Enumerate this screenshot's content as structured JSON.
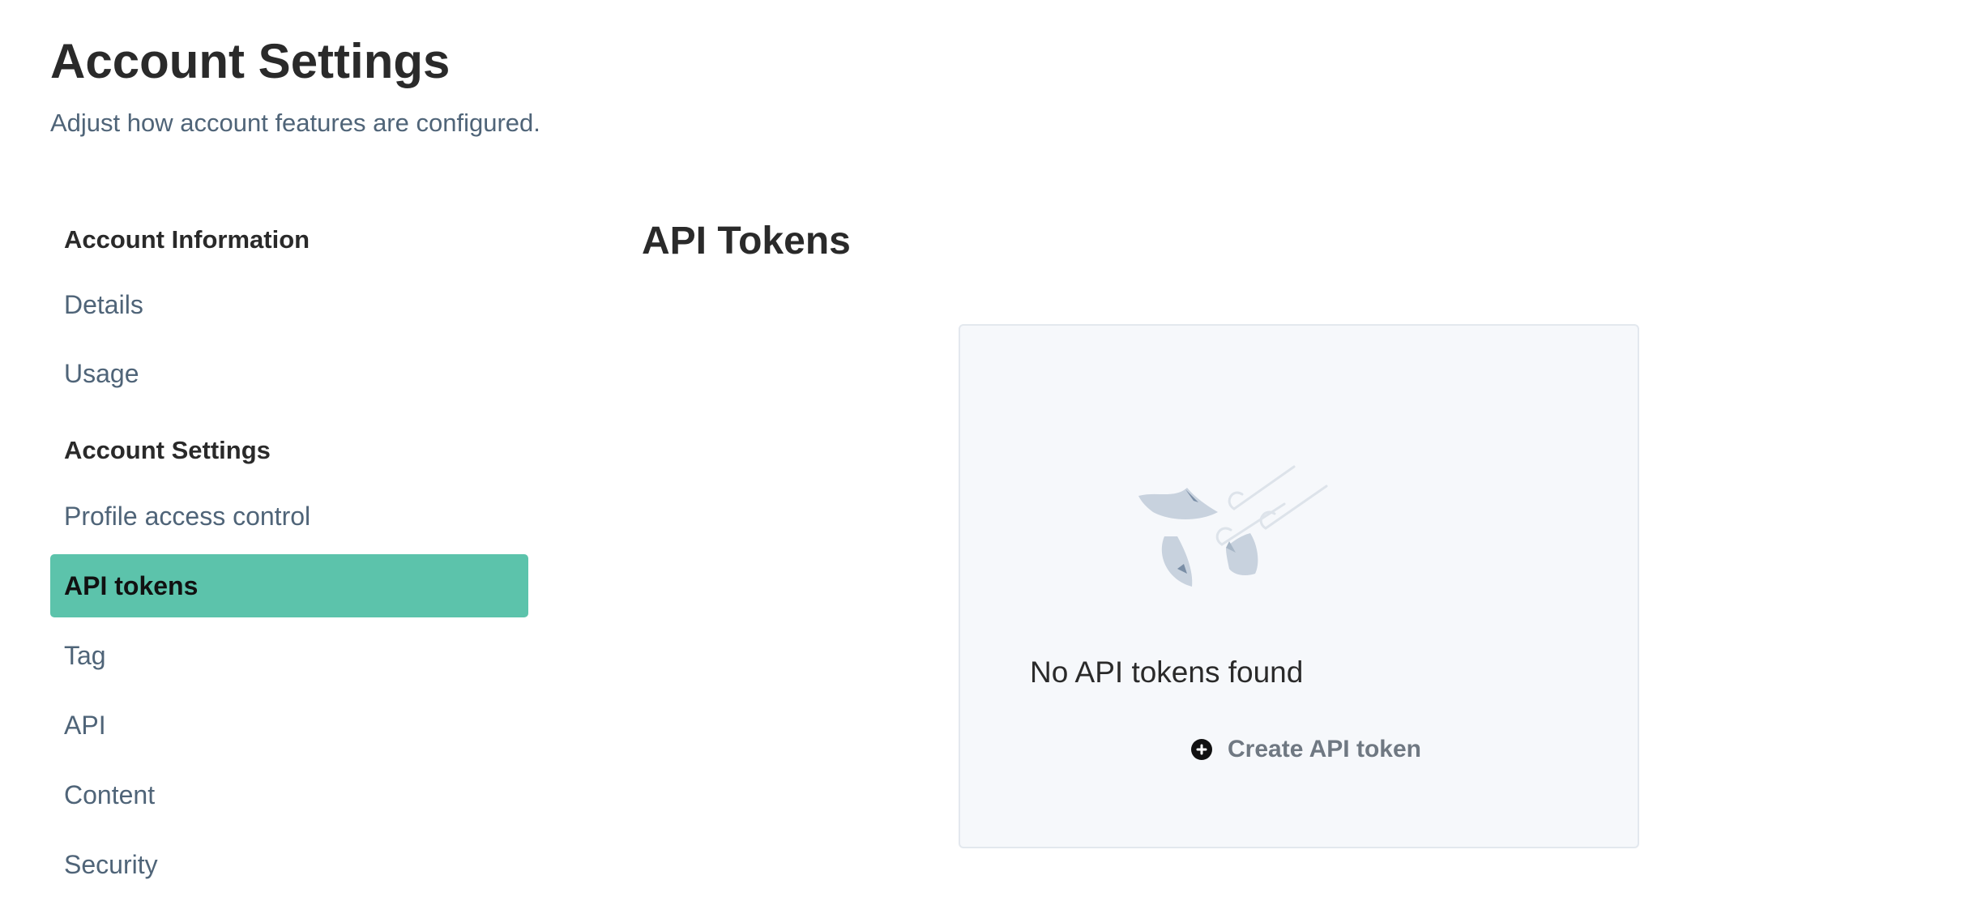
{
  "header": {
    "title": "Account Settings",
    "subtitle": "Adjust how account features are configured."
  },
  "sidebar": {
    "groups": [
      {
        "heading": "Account Information",
        "items": [
          {
            "label": "Details"
          },
          {
            "label": "Usage"
          }
        ]
      },
      {
        "heading": "Account Settings",
        "items": [
          {
            "label": "Profile access control"
          },
          {
            "label": "API tokens",
            "active": true
          },
          {
            "label": "Tag"
          },
          {
            "label": "API"
          },
          {
            "label": "Content"
          },
          {
            "label": "Security"
          }
        ]
      }
    ],
    "active_color": "#5cc3ab"
  },
  "main": {
    "section_title": "API Tokens",
    "empty_state": {
      "illustration_icon": "flying-papers-icon",
      "message": "No API tokens found",
      "create_label": "Create API token",
      "create_icon": "plus-circle-icon"
    }
  }
}
